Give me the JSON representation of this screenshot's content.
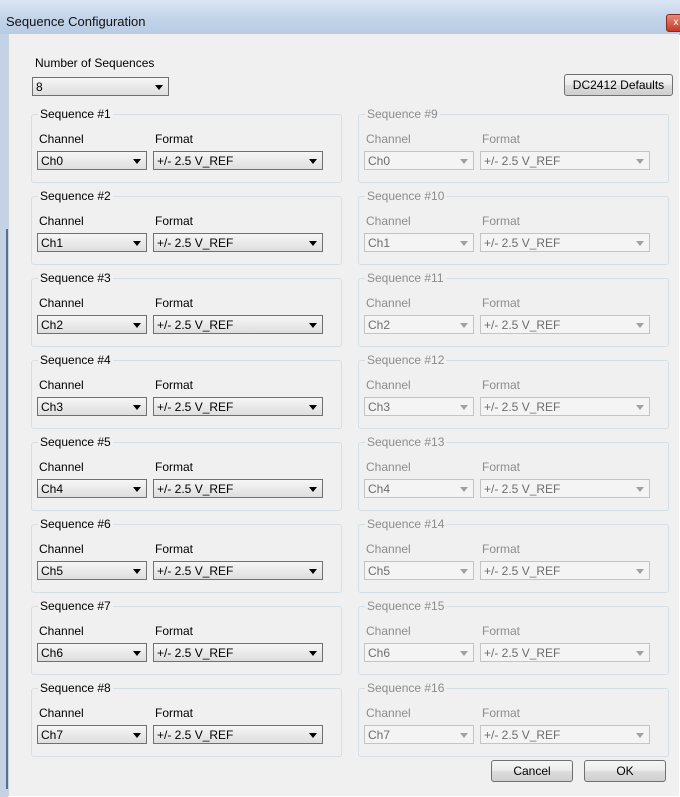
{
  "window": {
    "title": "Sequence Configuration",
    "close_glyph": "x"
  },
  "num_sequences": {
    "label": "Number of Sequences",
    "value": "8"
  },
  "defaults_button": "DC2412 Defaults",
  "channel_label": "Channel",
  "format_label": "Format",
  "sequences": [
    {
      "title": "Sequence #1",
      "channel": "Ch0",
      "format": "+/- 2.5 V_REF",
      "enabled": true
    },
    {
      "title": "Sequence #2",
      "channel": "Ch1",
      "format": "+/- 2.5 V_REF",
      "enabled": true
    },
    {
      "title": "Sequence #3",
      "channel": "Ch2",
      "format": "+/- 2.5 V_REF",
      "enabled": true
    },
    {
      "title": "Sequence #4",
      "channel": "Ch3",
      "format": "+/- 2.5 V_REF",
      "enabled": true
    },
    {
      "title": "Sequence #5",
      "channel": "Ch4",
      "format": "+/- 2.5 V_REF",
      "enabled": true
    },
    {
      "title": "Sequence #6",
      "channel": "Ch5",
      "format": "+/- 2.5 V_REF",
      "enabled": true
    },
    {
      "title": "Sequence #7",
      "channel": "Ch6",
      "format": "+/- 2.5 V_REF",
      "enabled": true
    },
    {
      "title": "Sequence #8",
      "channel": "Ch7",
      "format": "+/- 2.5 V_REF",
      "enabled": true
    },
    {
      "title": "Sequence #9",
      "channel": "Ch0",
      "format": "+/- 2.5 V_REF",
      "enabled": false
    },
    {
      "title": "Sequence #10",
      "channel": "Ch1",
      "format": "+/- 2.5 V_REF",
      "enabled": false
    },
    {
      "title": "Sequence #11",
      "channel": "Ch2",
      "format": "+/- 2.5 V_REF",
      "enabled": false
    },
    {
      "title": "Sequence #12",
      "channel": "Ch3",
      "format": "+/- 2.5 V_REF",
      "enabled": false
    },
    {
      "title": "Sequence #13",
      "channel": "Ch4",
      "format": "+/- 2.5 V_REF",
      "enabled": false
    },
    {
      "title": "Sequence #14",
      "channel": "Ch5",
      "format": "+/- 2.5 V_REF",
      "enabled": false
    },
    {
      "title": "Sequence #15",
      "channel": "Ch6",
      "format": "+/- 2.5 V_REF",
      "enabled": false
    },
    {
      "title": "Sequence #16",
      "channel": "Ch7",
      "format": "+/- 2.5 V_REF",
      "enabled": false
    }
  ],
  "cancel_button": "Cancel",
  "ok_button": "OK"
}
